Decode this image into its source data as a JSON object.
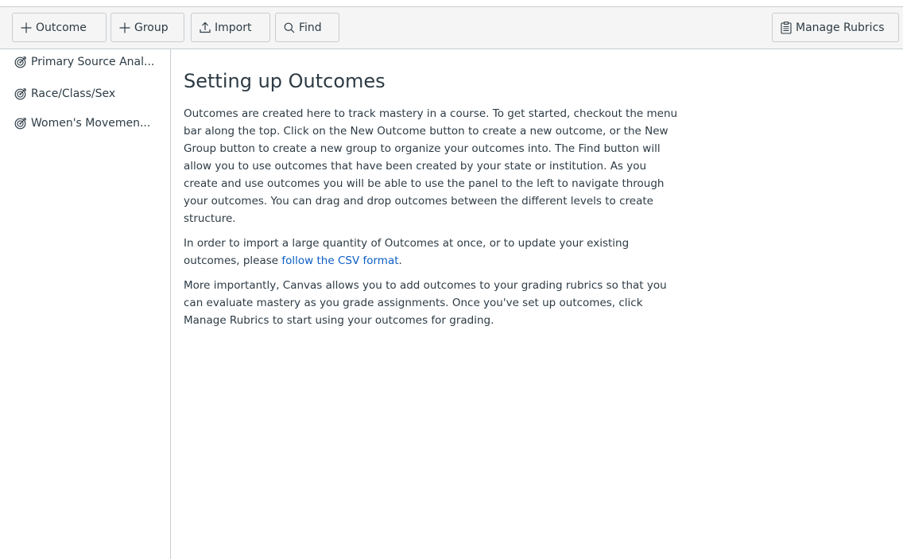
{
  "toolbar": {
    "outcome_label": "Outcome",
    "group_label": "Group",
    "import_label": "Import",
    "find_label": "Find",
    "manage_rubrics_label": "Manage Rubrics"
  },
  "sidebar": {
    "items": [
      {
        "label": "Primary Source Anal..."
      },
      {
        "label": "Race/Class/Sex"
      },
      {
        "label": "Women's Movemen..."
      }
    ]
  },
  "main": {
    "title": "Setting up Outcomes",
    "paragraph1": "Outcomes are created here to track mastery in a course. To get started, checkout the menu bar along the top. Click on the New Outcome button to create a new outcome, or the New Group button to create a new group to organize your outcomes into. The Find button will allow you to use outcomes that have been created by your state or institution. As you create and use outcomes you will be able to use the panel to the left to navigate through your outcomes. You can drag and drop outcomes between the different levels to create structure.",
    "paragraph2_prefix": "In order to import a large quantity of Outcomes at once, or to update your existing outcomes, please ",
    "paragraph2_link": "follow the CSV format",
    "paragraph2_suffix": ".",
    "paragraph3": "More importantly, Canvas allows you to add outcomes to your grading rubrics so that you can evaluate mastery as you grade assignments. Once you've set up outcomes, click Manage Rubrics to start using your outcomes for grading."
  },
  "icons": {
    "toolbar": [
      "plus-icon",
      "plus-icon",
      "upload-icon",
      "search-icon",
      "clipboard-icon"
    ],
    "sidebar": [
      "target-icon",
      "target-icon",
      "target-icon"
    ]
  },
  "colors": {
    "text": "#2d3b45",
    "link": "#0b5ec6",
    "toolbar_bg": "#f5f5f5",
    "border": "#c7cdd1"
  }
}
